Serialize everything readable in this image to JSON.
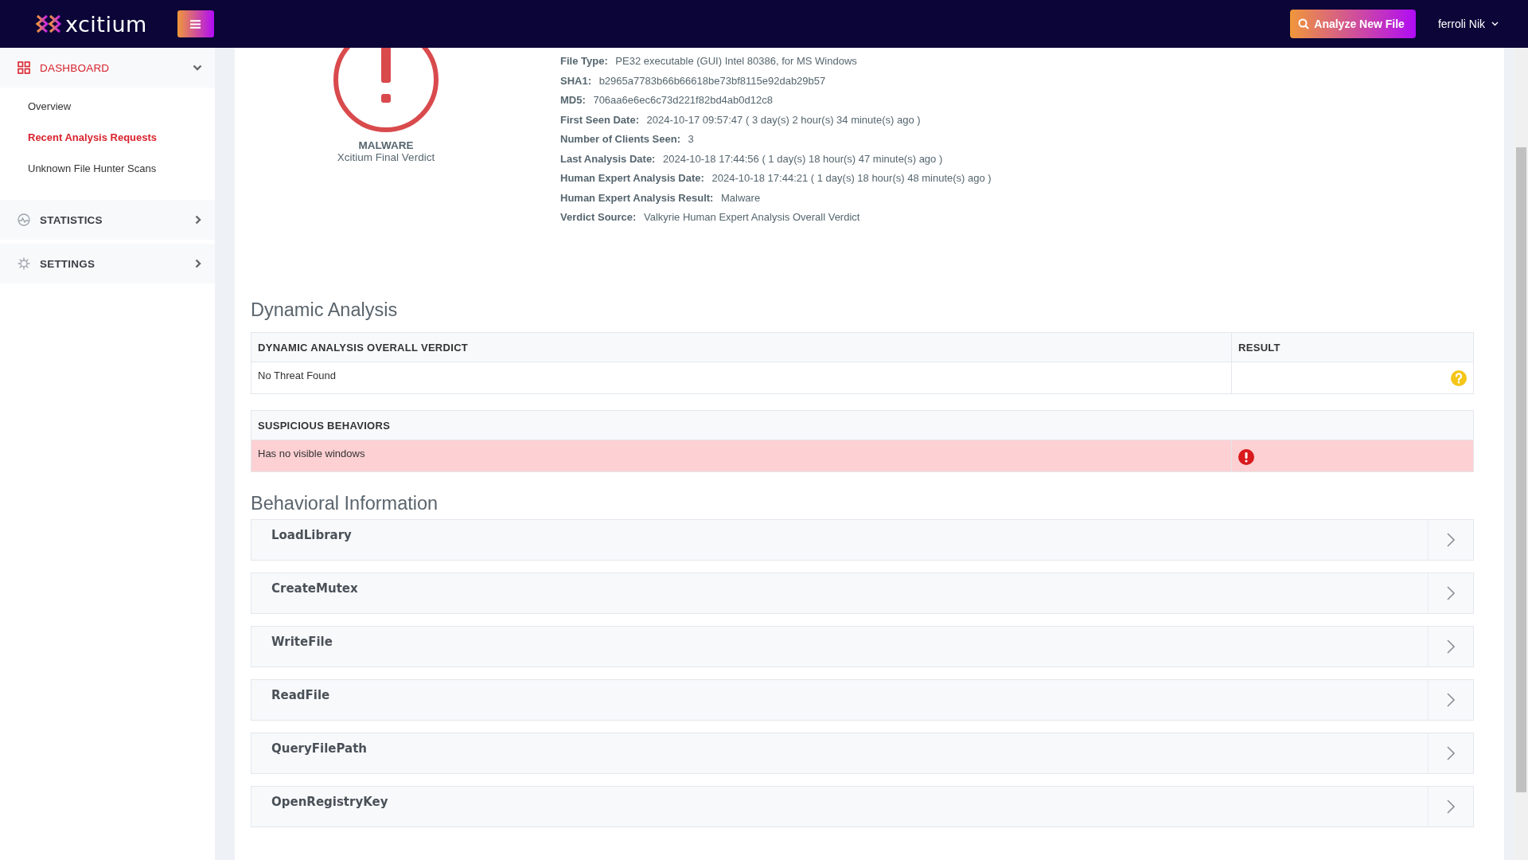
{
  "header": {
    "logo": "xcitium",
    "analyze_button": "Analyze New File",
    "user": "ferroli Nik"
  },
  "sidebar": {
    "sections": [
      {
        "kind": "dashboard",
        "label": "DASHBOARD",
        "selected": true,
        "expanded": true,
        "items": [
          {
            "label": "Overview",
            "selected": false
          },
          {
            "label": "Recent Analysis Requests",
            "selected": true
          },
          {
            "label": "Unknown File Hunter Scans",
            "selected": false
          }
        ]
      },
      {
        "kind": "statistics",
        "label": "STATISTICS",
        "selected": false,
        "expanded": false
      },
      {
        "kind": "settings",
        "label": "SETTINGS",
        "selected": false,
        "expanded": false
      }
    ]
  },
  "verdict": {
    "label": "MALWARE",
    "caption": "Xcitium Final Verdict"
  },
  "file_info": [
    {
      "label": "File Type:",
      "value": "PE32 executable (GUI) Intel 80386, for MS Windows"
    },
    {
      "label": "SHA1:",
      "value": "b2965a7783b66b66618be73bf8115e92dab29b57"
    },
    {
      "label": "MD5:",
      "value": "706aa6e6ec6c73d221f82bd4ab0d12c8"
    },
    {
      "label": "First Seen Date:",
      "value": "2024-10-17 09:57:47 ( 3 day(s) 2 hour(s) 34 minute(s) ago )"
    },
    {
      "label": "Number of Clients Seen:",
      "value": "3"
    },
    {
      "label": "Last Analysis Date:",
      "value": "2024-10-18 17:44:56 ( 1 day(s) 18 hour(s) 47 minute(s) ago )"
    },
    {
      "label": "Human Expert Analysis Date:",
      "value": "2024-10-18 17:44:21 ( 1 day(s) 18 hour(s) 48 minute(s) ago )"
    },
    {
      "label": "Human Expert Analysis Result:",
      "value": "Malware"
    },
    {
      "label": "Verdict Source:",
      "value": "Valkyrie Human Expert Analysis Overall Verdict"
    }
  ],
  "dynamic_analysis": {
    "title": "Dynamic Analysis",
    "columns": [
      "DYNAMIC ANALYSIS OVERALL VERDICT",
      "RESULT"
    ],
    "rows": [
      {
        "verdict": "No Threat Found",
        "kind": "unknown"
      }
    ],
    "suspicious": {
      "title": "SUSPICIOUS BEHAVIORS",
      "rows": [
        {
          "behavior": "Has no visible windows",
          "kind": "malicious"
        }
      ]
    }
  },
  "behavioral_information": {
    "title": "Behavioral Information",
    "items": [
      {
        "label": "LoadLibrary",
        "expanded": false
      },
      {
        "label": "CreateMutex",
        "expanded": false
      },
      {
        "label": "WriteFile",
        "expanded": false
      },
      {
        "label": "ReadFile",
        "expanded": false
      },
      {
        "label": "QueryFilePath",
        "expanded": false
      },
      {
        "label": "OpenRegistryKey",
        "expanded": false
      }
    ]
  }
}
